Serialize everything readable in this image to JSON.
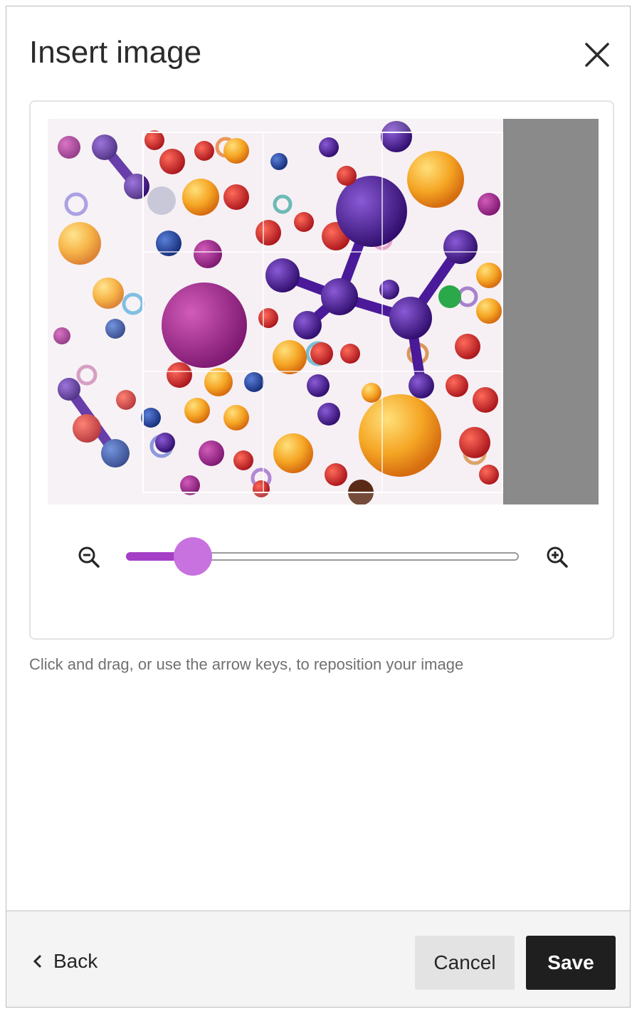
{
  "dialog": {
    "title": "Insert image",
    "close_icon": "close-icon"
  },
  "editor": {
    "image_description": "",
    "zoom_out_icon": "zoom-out-icon",
    "zoom_in_icon": "zoom-in-icon",
    "zoom_level": 0.17,
    "accent_color": "#a43fc6",
    "thumb_color": "#c772df",
    "hint": "Click and drag, or use the arrow keys, to reposition your image"
  },
  "footer": {
    "back_label": "Back",
    "back_icon": "chevron-left-icon",
    "cancel_label": "Cancel",
    "save_label": "Save"
  }
}
